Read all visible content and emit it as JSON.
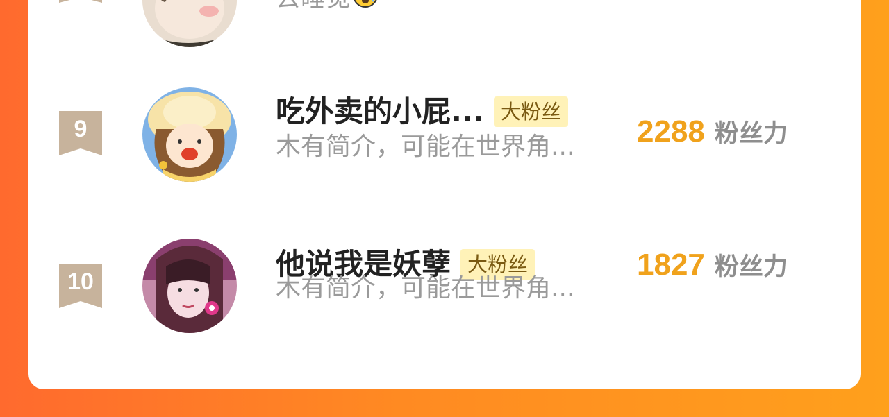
{
  "partial_row": {
    "intro": "去睡觉"
  },
  "rows": [
    {
      "rank": "9",
      "name": "吃外卖的小屁...",
      "tag": "大粉丝",
      "intro": "木有简介，可能在世界角...",
      "score": "2288",
      "score_unit": "粉丝力"
    },
    {
      "rank": "10",
      "name": "他说我是妖孽",
      "tag": "大粉丝",
      "intro": "木有简介，可能在世界角...",
      "score": "1827",
      "score_unit": "粉丝力"
    }
  ],
  "colors": {
    "accent": "#f0a21c",
    "badge": "#c7b39c",
    "tag_bg": "#fff2b8"
  }
}
